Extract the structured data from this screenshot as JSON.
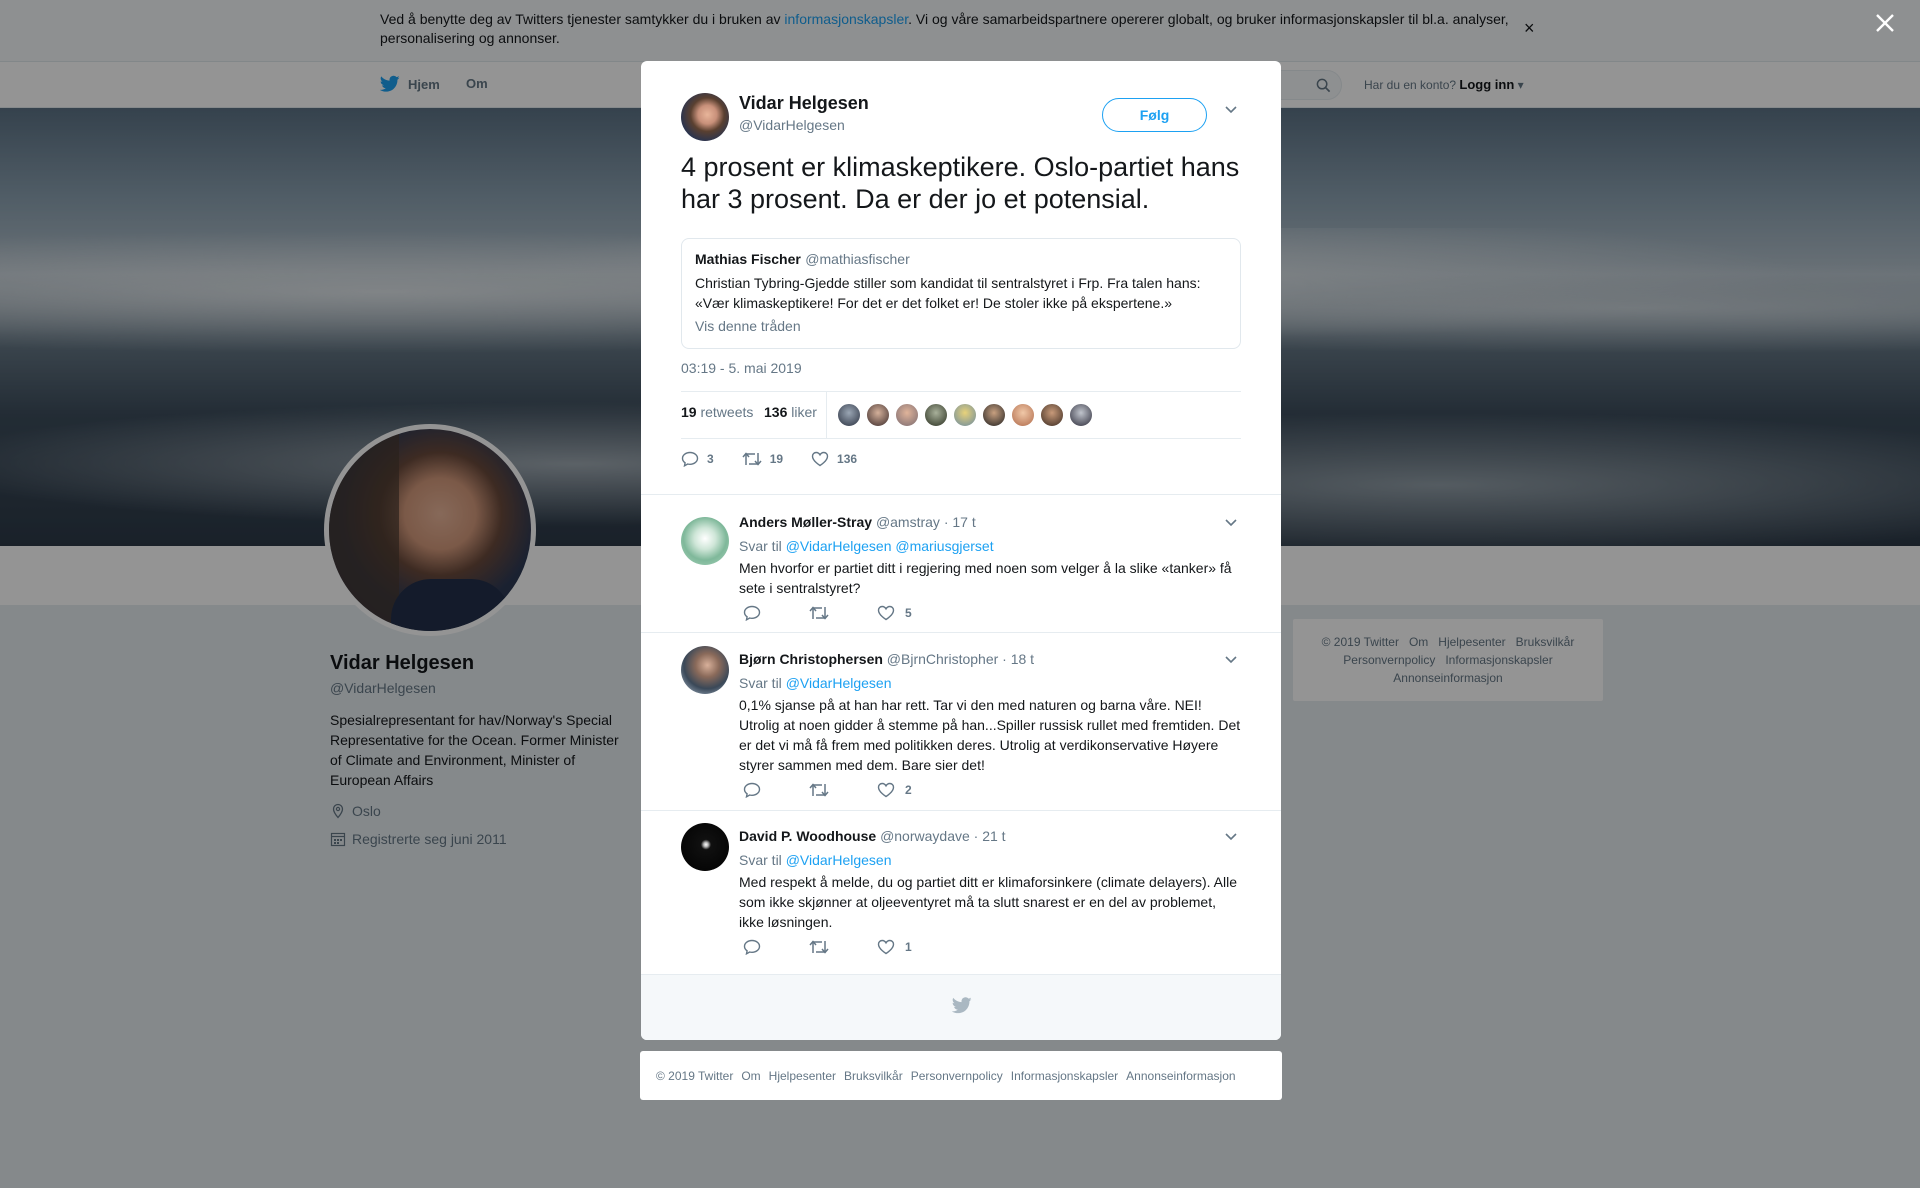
{
  "cookie_bar": {
    "text_before": "Ved å benytte deg av Twitters tjenester samtykker du i bruken av ",
    "link": "informasjonskapsler",
    "text_after": ". Vi og våre samarbeidspartnere opererer globalt, og bruker informasjonskapsler til bl.a. analyser, personalisering og annonser.",
    "close": "×"
  },
  "nav": {
    "home": "Hjem",
    "about": "Om",
    "account_prompt": "Har du en konto?",
    "login": "Logg inn"
  },
  "profile": {
    "name": "Vidar Helgesen",
    "handle": "@VidarHelgesen",
    "bio": "Spesialrepresentant for hav/Norway's Special Representative for the Ocean. Former Minister of Climate and Environment, Minister of European Affairs",
    "location": "Oslo",
    "joined": "Registrerte seg juni 2011"
  },
  "side_footer": [
    "© 2019 Twitter",
    "Om",
    "Hjelpesenter",
    "Bruksvilkår",
    "Personvernpolicy",
    "Informasjonskapsler",
    "Annonseinformasjon"
  ],
  "tweet": {
    "author_name": "Vidar Helgesen",
    "author_handle": "@VidarHelgesen",
    "follow": "Følg",
    "text": "4 prosent er klimaskeptikere. Oslo-partiet hans har 3 prosent. Da er der jo et potensial.",
    "quote": {
      "name": "Mathias Fischer",
      "handle": "@mathiasfischer",
      "text": "Christian Tybring-Gjedde stiller som kandidat til sentralstyret i Frp. Fra talen hans: «Vær klimaskeptikere! For det er det folket er! De stoler ikke på ekspertene.»",
      "link": "Vis denne tråden"
    },
    "timestamp": "03:19 - 5. mai 2019",
    "retweets_count": "19",
    "retweets_label": "retweets",
    "likes_count": "136",
    "likes_label": "liker",
    "actions": {
      "reply": "3",
      "retweet": "19",
      "like": "136"
    }
  },
  "replies": [
    {
      "name": "Anders Møller-Stray",
      "handle": "@amstray",
      "time": "· 17 t",
      "svar_label": "Svar til",
      "mentions": "@VidarHelgesen @mariusgjerset",
      "text": "Men hvorfor er partiet ditt i regjering med noen som velger å la slike «tanker» få sete i sentralstyret?",
      "likes": "5"
    },
    {
      "name": "Bjørn Christophersen",
      "handle": "@BjrnChristopher",
      "time": "· 18 t",
      "svar_label": "Svar til",
      "mentions": "@VidarHelgesen",
      "text": "0,1% sjanse på at han har rett. Tar vi den med naturen og barna våre. NEI! Utrolig at noen gidder å stemme på han...Spiller russisk rullet med fremtiden. Det er det vi må få frem med politikken deres. Utrolig at verdikonservative  Høyere styrer sammen med dem. Bare sier det!",
      "likes": "2"
    },
    {
      "name": "David P. Woodhouse",
      "handle": "@norwaydave",
      "time": "· 21 t",
      "svar_label": "Svar til",
      "mentions": "@VidarHelgesen",
      "text": "Med respekt å melde, du og partiet ditt er klimaforsinkere (climate delayers). Alle som ikke skjønner at oljeeventyret må ta slutt snarest er en del av problemet, ikke løsningen.",
      "likes": "1"
    }
  ],
  "bottom_footer": [
    "© 2019 Twitter",
    "Om",
    "Hjelpesenter",
    "Bruksvilkår",
    "Personvernpolicy",
    "Informasjonskapsler",
    "Annonseinformasjon"
  ],
  "colors": {
    "twitter_blue": "#1da1f2",
    "secondary_text": "#657786",
    "overlay": "rgba(0,0,0,0.42)"
  },
  "icons": [
    "twitter-bird-icon",
    "search-icon",
    "close-icon",
    "chevron-down-icon",
    "reply-icon",
    "retweet-icon",
    "heart-icon",
    "location-icon",
    "calendar-icon"
  ]
}
